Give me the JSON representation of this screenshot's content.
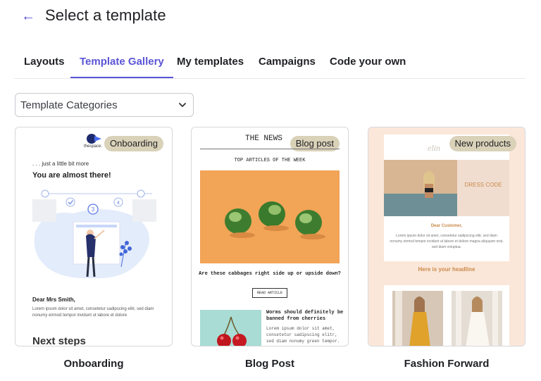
{
  "header": {
    "back_icon": "arrow-left-icon",
    "title": "Select a template"
  },
  "tabs": [
    {
      "label": "Layouts",
      "active": false
    },
    {
      "label": "Template Gallery",
      "active": true
    },
    {
      "label": "My templates",
      "active": false
    },
    {
      "label": "Campaigns",
      "active": false
    },
    {
      "label": "Code your own",
      "active": false
    }
  ],
  "category_select": {
    "value": "Template Categories",
    "icon": "chevron-down-icon"
  },
  "accent_color": "#5b55d6",
  "badge_color": "#d9d1b8",
  "cards": [
    {
      "name": "Onboarding",
      "badge": "Onboarding",
      "preview": {
        "logo_text": "thespace.",
        "intro": ". . . just a little bit more",
        "heading": "You are almost there!",
        "step_numbers": [
          "3",
          "4"
        ],
        "greeting": "Dear Mrs Smith,",
        "body": "Lorem ipsum dolor sit amet, consetetur sadipscing elitr, sed diam nonumy eirmod tempor invidunt ut labore et dolore",
        "section_title": "Next steps"
      }
    },
    {
      "name": "Blog Post",
      "badge": "Blog post",
      "preview": {
        "masthead": "THE NEWS",
        "subhead": "TOP ARTICLES OF THE WEEK",
        "caption": "Are these cabbages right side up or upside down?",
        "button": "READ ARTICLE",
        "article_title": "Worms should definitely be banned from cherries",
        "article_body": "Lorem ipsum dolor sit amet, consetetur sadipscing elitr, sed diam nonumy green tempor."
      }
    },
    {
      "name": "Fashion Forward",
      "badge": "New products",
      "preview": {
        "logo": "elin",
        "hero_text": "DRESS CODE",
        "greeting": "Dear Customer,",
        "body": "Lorem ipsum dolor sit amet, consetetur sadipscing elitr, sed diam nonumy eirmod tempor invidunt ut labore et dolore magna aliquyam erat, sed diam voluptua.",
        "headline": "Here is your headline"
      }
    }
  ]
}
